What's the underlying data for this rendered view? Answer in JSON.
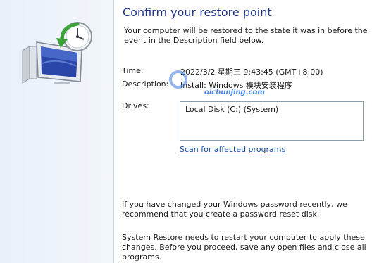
{
  "window": {
    "title": "Confirm your restore point"
  },
  "intro": "Your computer will be restored to the state it was in before the event in the Description field below.",
  "fields": {
    "time_label": "Time:",
    "time_value": "2022/3/2 星期三 9:43:45 (GMT+8:00)",
    "description_label": "Description:",
    "description_value": "Install: Windows 模块安装程序",
    "drives_label": "Drives:"
  },
  "drives": [
    "Local Disk (C:) (System)"
  ],
  "scan_link": "Scan for affected programs",
  "notes": {
    "password": "If you have changed your Windows password recently, we recommend that you create a password reset disk.",
    "restart": "System Restore needs to restart your computer to apply these changes. Before you proceed, save any open files and close all programs."
  },
  "watermark": {
    "url": "oichunjing.com"
  },
  "icons": {
    "graphic": "system-restore-icon"
  },
  "colors": {
    "title": "#1e3287",
    "link": "#1b4ea1",
    "panel": "#e9f0f8"
  }
}
